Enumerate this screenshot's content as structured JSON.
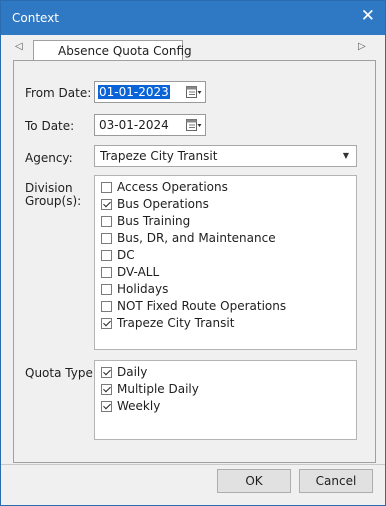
{
  "window": {
    "title": "Context",
    "close_glyph": "✕"
  },
  "tabs": [
    {
      "label": "Absence Quota Config",
      "active": true
    }
  ],
  "nav": {
    "left_glyph": "◁",
    "right_glyph": "▷"
  },
  "form": {
    "from_date": {
      "label": "From Date:",
      "value": "01-01-2023",
      "selected": true
    },
    "to_date": {
      "label": "To Date:",
      "value": "03-01-2024"
    },
    "agency": {
      "label": "Agency:",
      "value": "Trapeze City Transit"
    },
    "division_groups": {
      "label_line1": "Division",
      "label_line2": "Group(s):",
      "items": [
        {
          "label": "Access Operations",
          "checked": false
        },
        {
          "label": "Bus Operations",
          "checked": true
        },
        {
          "label": "Bus Training",
          "checked": false
        },
        {
          "label": "Bus, DR, and Maintenance",
          "checked": false
        },
        {
          "label": "DC",
          "checked": false
        },
        {
          "label": "DV-ALL",
          "checked": false
        },
        {
          "label": "Holidays",
          "checked": false
        },
        {
          "label": "NOT Fixed Route Operations",
          "checked": false
        },
        {
          "label": "Trapeze City Transit",
          "checked": true
        }
      ]
    },
    "quota_type": {
      "label": "Quota Type:",
      "items": [
        {
          "label": "Daily",
          "checked": true
        },
        {
          "label": "Multiple Daily",
          "checked": true
        },
        {
          "label": "Weekly",
          "checked": true
        }
      ]
    }
  },
  "buttons": {
    "ok": "OK",
    "cancel": "Cancel"
  },
  "colors": {
    "titlebar": "#2f78c4",
    "selection": "#0a64d8"
  }
}
